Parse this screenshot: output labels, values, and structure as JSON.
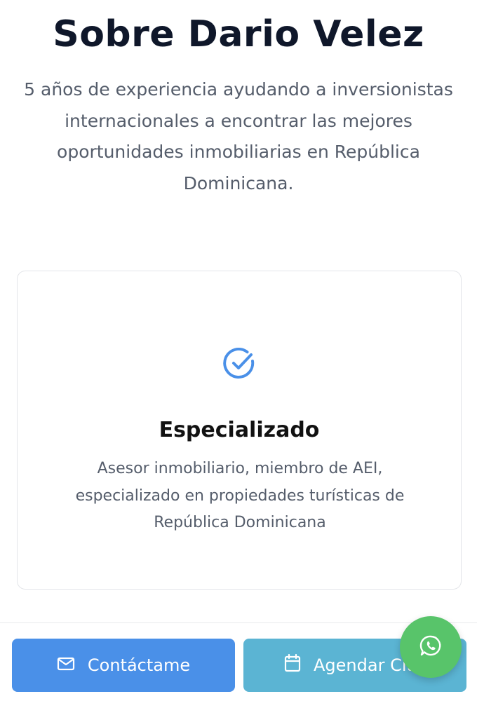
{
  "about": {
    "title": "Sobre Dario Velez",
    "subtitle": "5 años de experiencia ayudando a inversionistas internacionales a encontrar las mejores oportunidades inmobiliarias en República Dominicana."
  },
  "card": {
    "icon": "check-circle-icon",
    "title": "Especializado",
    "description": "Asesor inmobiliario, miembro de AEI, especializado en propiedades turísticas de República Dominicana"
  },
  "bottom_bar": {
    "contact_label": "Contáctame",
    "contact_icon": "mail-icon",
    "schedule_label": "Agendar Cita",
    "schedule_icon": "calendar-icon"
  },
  "fab": {
    "icon": "whatsapp-icon"
  },
  "colors": {
    "title": "#0f172a",
    "accent_blue": "#4a90e8",
    "schedule_button": "#5bb4d3",
    "whatsapp_green": "#58c46a"
  }
}
